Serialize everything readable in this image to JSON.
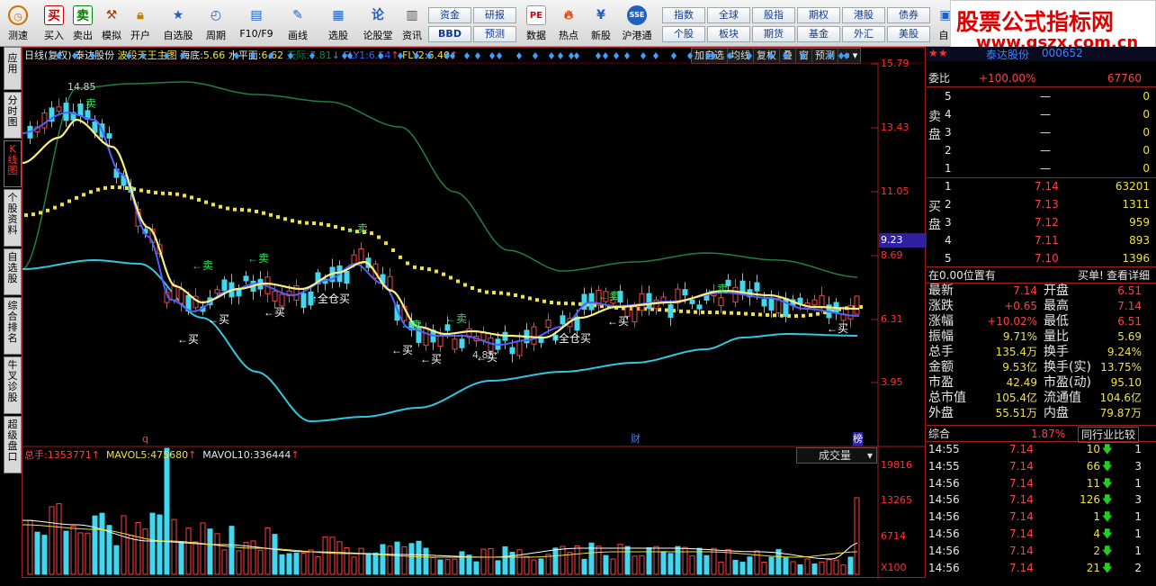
{
  "toolbar": {
    "items": [
      {
        "label": "测速",
        "icon": "clock"
      },
      {
        "label": "买入",
        "icon": "buy"
      },
      {
        "label": "卖出",
        "icon": "sell"
      },
      {
        "label": "模拟",
        "icon": "hammer"
      },
      {
        "label": "开户",
        "icon": "lock"
      },
      {
        "label": "自选股",
        "icon": "star"
      },
      {
        "label": "周期",
        "icon": "period"
      },
      {
        "label": "F10/F9",
        "icon": "f10"
      },
      {
        "label": "画线",
        "icon": "pen"
      },
      {
        "label": "选股",
        "icon": "select"
      },
      {
        "label": "论股堂",
        "icon": "discuss"
      },
      {
        "label": "资讯",
        "icon": "news"
      },
      {
        "label": "数据",
        "icon": "pe"
      },
      {
        "label": "热点",
        "icon": "hot"
      },
      {
        "label": "新股",
        "icon": "newstock"
      },
      {
        "label": "沪港通",
        "icon": "hk"
      }
    ],
    "grid_buttons": [
      "资金",
      "研报",
      "BBD",
      "预测",
      "指数",
      "全球",
      "股指",
      "期权",
      "港股",
      "债券",
      "个股",
      "板块",
      "期货",
      "基金",
      "外汇",
      "美股"
    ],
    "last_item": "自选"
  },
  "brand": {
    "title": "股票公式指标网",
    "url": "www.gszx.com.cn"
  },
  "nav": {
    "tabs": [
      "应用",
      "分时图",
      "K线图",
      "个股资料",
      "自选股",
      "综合排名",
      "牛叉诊股",
      "超级盘口"
    ]
  },
  "chart": {
    "period": "日线(复权)",
    "stock_name": "泰达股份",
    "indicator": "波段天王主图",
    "haidi_label": "海底:",
    "haidi": "5.66",
    "shuiping_label": "水平面:",
    "shuiping": "6.62",
    "tianji_label": "天际:",
    "tianji": "7.81",
    "fly1_label": "FLY1:",
    "fly1": "6.54",
    "fly2_label": "FLY2:",
    "fly2": "6.40",
    "buttons": [
      "加自选",
      "均线",
      "复权",
      "叠",
      "窗",
      "预测"
    ],
    "price_axis": [
      "15.79",
      "13.43",
      "11.05",
      "9.23",
      "8.69",
      "6.31",
      "3.95"
    ],
    "current_price": "9.23",
    "peak": "14.85",
    "low": "4.85",
    "signals": {
      "buy": "买",
      "sell": "卖",
      "full_buy": "全仓买"
    },
    "markers": {
      "q": "q",
      "cai": "财",
      "bang": "榜"
    },
    "vol_title": "总手:",
    "vol": "1353771",
    "mavol5_label": "MAVOL5:",
    "mavol5": "475680",
    "mavol10_label": "MAVOL10:",
    "mavol10": "336444",
    "vol_selector": "成交量",
    "vol_axis": [
      "19816",
      "13265",
      "6714",
      "X100"
    ]
  },
  "quote": {
    "stock": "泰达股份",
    "code": "000652",
    "weibi_label": "委比",
    "weibi": "+100.00%",
    "weicha": "67760",
    "sell_label": "卖盘",
    "buy_label": "买盘",
    "sells": [
      {
        "n": "5",
        "p": "—",
        "v": "0"
      },
      {
        "n": "4",
        "p": "—",
        "v": "0"
      },
      {
        "n": "3",
        "p": "—",
        "v": "0"
      },
      {
        "n": "2",
        "p": "—",
        "v": "0"
      },
      {
        "n": "1",
        "p": "—",
        "v": "0"
      }
    ],
    "buys": [
      {
        "n": "1",
        "p": "7.14",
        "v": "63201"
      },
      {
        "n": "2",
        "p": "7.13",
        "v": "1311"
      },
      {
        "n": "3",
        "p": "7.12",
        "v": "959"
      },
      {
        "n": "4",
        "p": "7.11",
        "v": "893"
      },
      {
        "n": "5",
        "p": "7.10",
        "v": "1396"
      }
    ],
    "pos": "在0.00位置有",
    "pos2": "买单!",
    "detail": "查看详细",
    "stats": [
      [
        "最新",
        "7.14",
        "开盘",
        "6.51"
      ],
      [
        "涨跌",
        "+0.65",
        "最高",
        "7.14"
      ],
      [
        "涨幅",
        "+10.02%",
        "最低",
        "6.51"
      ],
      [
        "振幅",
        "9.71%",
        "量比",
        "5.69"
      ],
      [
        "总手",
        "135.4万",
        "换手",
        "9.24%"
      ],
      [
        "金额",
        "9.53亿",
        "换手(实)",
        "13.75%"
      ],
      [
        "市盈",
        "42.49",
        "市盈(动)",
        "95.10"
      ],
      [
        "总市值",
        "105.4亿",
        "流通值",
        "104.6亿"
      ],
      [
        "外盘",
        "55.51万",
        "内盘",
        "79.87万"
      ]
    ],
    "zonghe_label": "综合",
    "zonghe": "1.87%",
    "compare": "同行业比较",
    "ticks": [
      [
        "14:55",
        "7.14",
        "10",
        "1"
      ],
      [
        "14:55",
        "7.14",
        "66",
        "3"
      ],
      [
        "14:56",
        "7.14",
        "11",
        "1"
      ],
      [
        "14:56",
        "7.14",
        "126",
        "3"
      ],
      [
        "14:56",
        "7.14",
        "1",
        "1"
      ],
      [
        "14:56",
        "7.14",
        "4",
        "1"
      ],
      [
        "14:56",
        "7.14",
        "2",
        "1"
      ],
      [
        "14:56",
        "7.14",
        "21",
        "2"
      ]
    ]
  }
}
